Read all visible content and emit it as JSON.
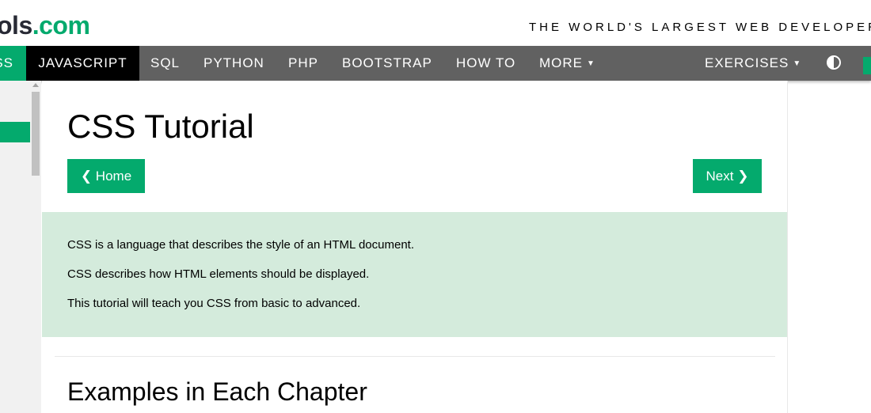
{
  "header": {
    "logo_dark": "ols",
    "logo_green": ".com",
    "tagline": "THE WORLD'S LARGEST WEB DEVELOPER"
  },
  "nav": {
    "items": [
      {
        "label": "SS",
        "active": false
      },
      {
        "label": "JAVASCRIPT",
        "active": true
      },
      {
        "label": "SQL"
      },
      {
        "label": "PYTHON"
      },
      {
        "label": "PHP"
      },
      {
        "label": "BOOTSTRAP"
      },
      {
        "label": "HOW TO"
      },
      {
        "label": "MORE"
      },
      {
        "label": "EXERCISES"
      }
    ],
    "theme_toggle_icon": "contrast-icon"
  },
  "main": {
    "title": "CSS Tutorial",
    "home_button": "❮ Home",
    "next_button": "Next ❯",
    "intro": [
      "CSS is a language that describes the style of an HTML document.",
      "CSS describes how HTML elements should be displayed.",
      "This tutorial will teach you CSS from basic to advanced."
    ],
    "section_title": "Examples in Each Chapter"
  },
  "colors": {
    "brand_green": "#04aa6d",
    "nav_bg": "#616161",
    "intro_bg": "#d4ebdc"
  }
}
